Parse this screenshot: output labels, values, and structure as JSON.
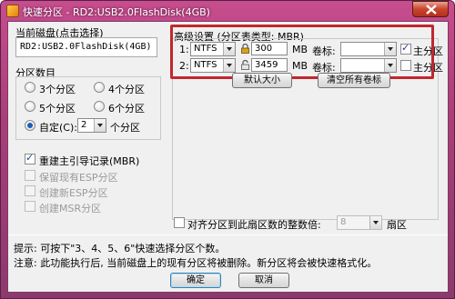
{
  "window": {
    "title": "快速分区 - RD2:USB2.0FlashDisk(4GB)"
  },
  "disk": {
    "label": "当前磁盘(点击选择)",
    "value": "RD2:USB2.0FlashDisk(4GB)",
    "arrow": "-"
  },
  "count": {
    "label": "分区数目",
    "options": [
      "3个分区",
      "4个分区",
      "5个分区",
      "6个分区"
    ],
    "custom_label": "自定(C):",
    "custom_value": "2",
    "custom_suffix": "个分区"
  },
  "options": {
    "rebuild_mbr": "重建主引导记录(MBR)",
    "keep_esp": "保留现有ESP分区",
    "create_esp": "创建新ESP分区",
    "create_msr": "创建MSR分区"
  },
  "advanced": {
    "label": "高级设置 (分区表类型: MBR)",
    "rows": [
      {
        "index": "1:",
        "fs": "NTFS",
        "size": "300",
        "unit": "MB",
        "vol_label": "卷标:",
        "vol_value": "",
        "primary": "主分区",
        "primary_checked": true
      },
      {
        "index": "2:",
        "fs": "NTFS",
        "size": "3459",
        "unit": "MB",
        "vol_label": "卷标:",
        "vol_value": "",
        "primary": "主分区",
        "primary_checked": false
      }
    ],
    "default_size_btn": "默认大小",
    "clear_labels_btn": "清空所有卷标"
  },
  "align": {
    "label": "对齐分区到此扇区数的整数倍:",
    "value": "8",
    "unit": "扇区"
  },
  "tips": {
    "line1": "提示: 可按下\"3、4、5、6\"快速选择分区个数。",
    "line2": "注意: 此功能执行后, 当前磁盘上的现有分区将被删除。新分区将会被快速格式化。"
  },
  "buttons": {
    "ok": "确定",
    "cancel": "取消"
  }
}
